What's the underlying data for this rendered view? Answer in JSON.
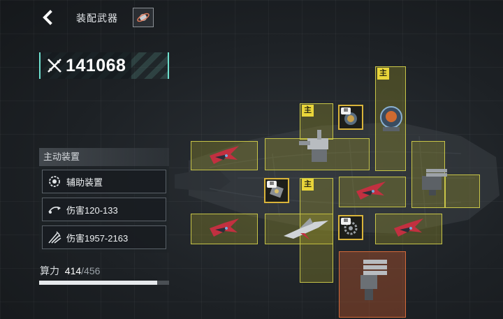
{
  "header": {
    "title": "装配武器",
    "back_icon": "chevron-left-icon",
    "orbit_icon": "planet-orbit-icon"
  },
  "power": {
    "value": "141068",
    "icon": "crossed-swords-icon"
  },
  "panel": {
    "title": "主动装置",
    "rows": [
      {
        "icon": "gear-circle-icon",
        "label": "辅助装置"
      },
      {
        "icon": "missile-launch-icon",
        "label": "伤害120-133"
      },
      {
        "icon": "multi-missile-icon",
        "label": "伤害1957-2163"
      }
    ]
  },
  "compute": {
    "label": "算力",
    "used": "414",
    "separator": "/",
    "max": "456",
    "fraction": 0.908
  },
  "slots": {
    "main_tag": "主",
    "module_tag": "III"
  },
  "colors": {
    "slot_yellow": "#c8c548",
    "slot_orange": "#d66a3a",
    "accent_teal": "#6fe0cf",
    "main_tag": "#e9d53a"
  }
}
